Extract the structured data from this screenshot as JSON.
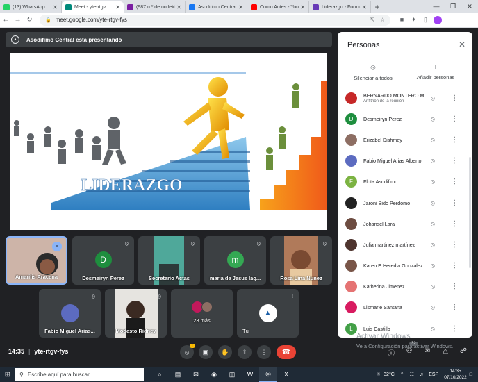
{
  "browser": {
    "tabs": [
      {
        "title": "(13) WhatsApp",
        "color": "#25d366",
        "active": false
      },
      {
        "title": "Meet - yte-rtgv",
        "color": "#00897b",
        "active": true
      },
      {
        "title": "(987 n.º de no leíd",
        "color": "#7b1fa2",
        "active": false
      },
      {
        "title": "Asodifimo Central",
        "color": "#1877f2",
        "active": false
      },
      {
        "title": "Como Antes - You",
        "color": "#ff0000",
        "active": false
      },
      {
        "title": "Liderazgo - Formu",
        "color": "#673ab7",
        "active": false
      }
    ],
    "new_tab": "+",
    "url": "meet.google.com/yte-rtgv-fys"
  },
  "meet": {
    "presenting_banner": "Asodifimo Central está presentando",
    "slide_title": "LIDERAZGO",
    "tiles": [
      {
        "name": "Amarilis Aracena",
        "speaking": true
      },
      {
        "name": "Desmeiryn Perez",
        "initial": "D",
        "color": "#1e8e3e"
      },
      {
        "name": "Secretario Actas"
      },
      {
        "name": "maria de Jesus lag...",
        "initial": "m",
        "color": "#34a853"
      },
      {
        "name": "Rosa Lina Nunez"
      },
      {
        "name": "Fabio Miguel Arias..."
      },
      {
        "name": "Modesto Ridney"
      },
      {
        "name": "23 más"
      },
      {
        "name": "Tú"
      }
    ],
    "meeting_time": "14:35",
    "meeting_code": "yte-rtgv-fys",
    "people_badge": "32",
    "mic_badge": "!"
  },
  "people_panel": {
    "title": "Personas",
    "mute_all": "Silenciar a todos",
    "add_people": "Añadir personas",
    "participants": [
      {
        "name": "BERNARDO MONTERO M...",
        "sub": "Anfitrión de la reunión",
        "color": "#c62828",
        "initial": ""
      },
      {
        "name": "Desmeiryn Perez",
        "color": "#1e8e3e",
        "initial": "D"
      },
      {
        "name": "Erizabel Dishmey",
        "color": "#8d6e63",
        "initial": ""
      },
      {
        "name": "Fabio Miguel Arias Alberto",
        "color": "#5c6bc0",
        "initial": ""
      },
      {
        "name": "Flota Asodifimo",
        "color": "#7cb342",
        "initial": "F"
      },
      {
        "name": "Jaroni Bido Perdomo",
        "color": "#212121",
        "initial": ""
      },
      {
        "name": "Johansel Lara",
        "color": "#6d4c41",
        "initial": ""
      },
      {
        "name": "Julia martinez martínez",
        "color": "#4e342e",
        "initial": ""
      },
      {
        "name": "Karen E Heredia Gonzalez",
        "color": "#795548",
        "initial": ""
      },
      {
        "name": "Katherina Jimenez",
        "color": "#e57373",
        "initial": ""
      },
      {
        "name": "Lismarie Santana",
        "color": "#d81b60",
        "initial": ""
      },
      {
        "name": "Luis Castillo",
        "color": "#43a047",
        "initial": "L"
      }
    ]
  },
  "watermark": {
    "line1": "Activar Windows",
    "line2": "Ve a Configuración para activar Windows."
  },
  "taskbar": {
    "search_placeholder": "Escribe aquí para buscar",
    "weather": "32°C",
    "language": "ESP",
    "time": "14:35",
    "date": "07/10/2022"
  }
}
